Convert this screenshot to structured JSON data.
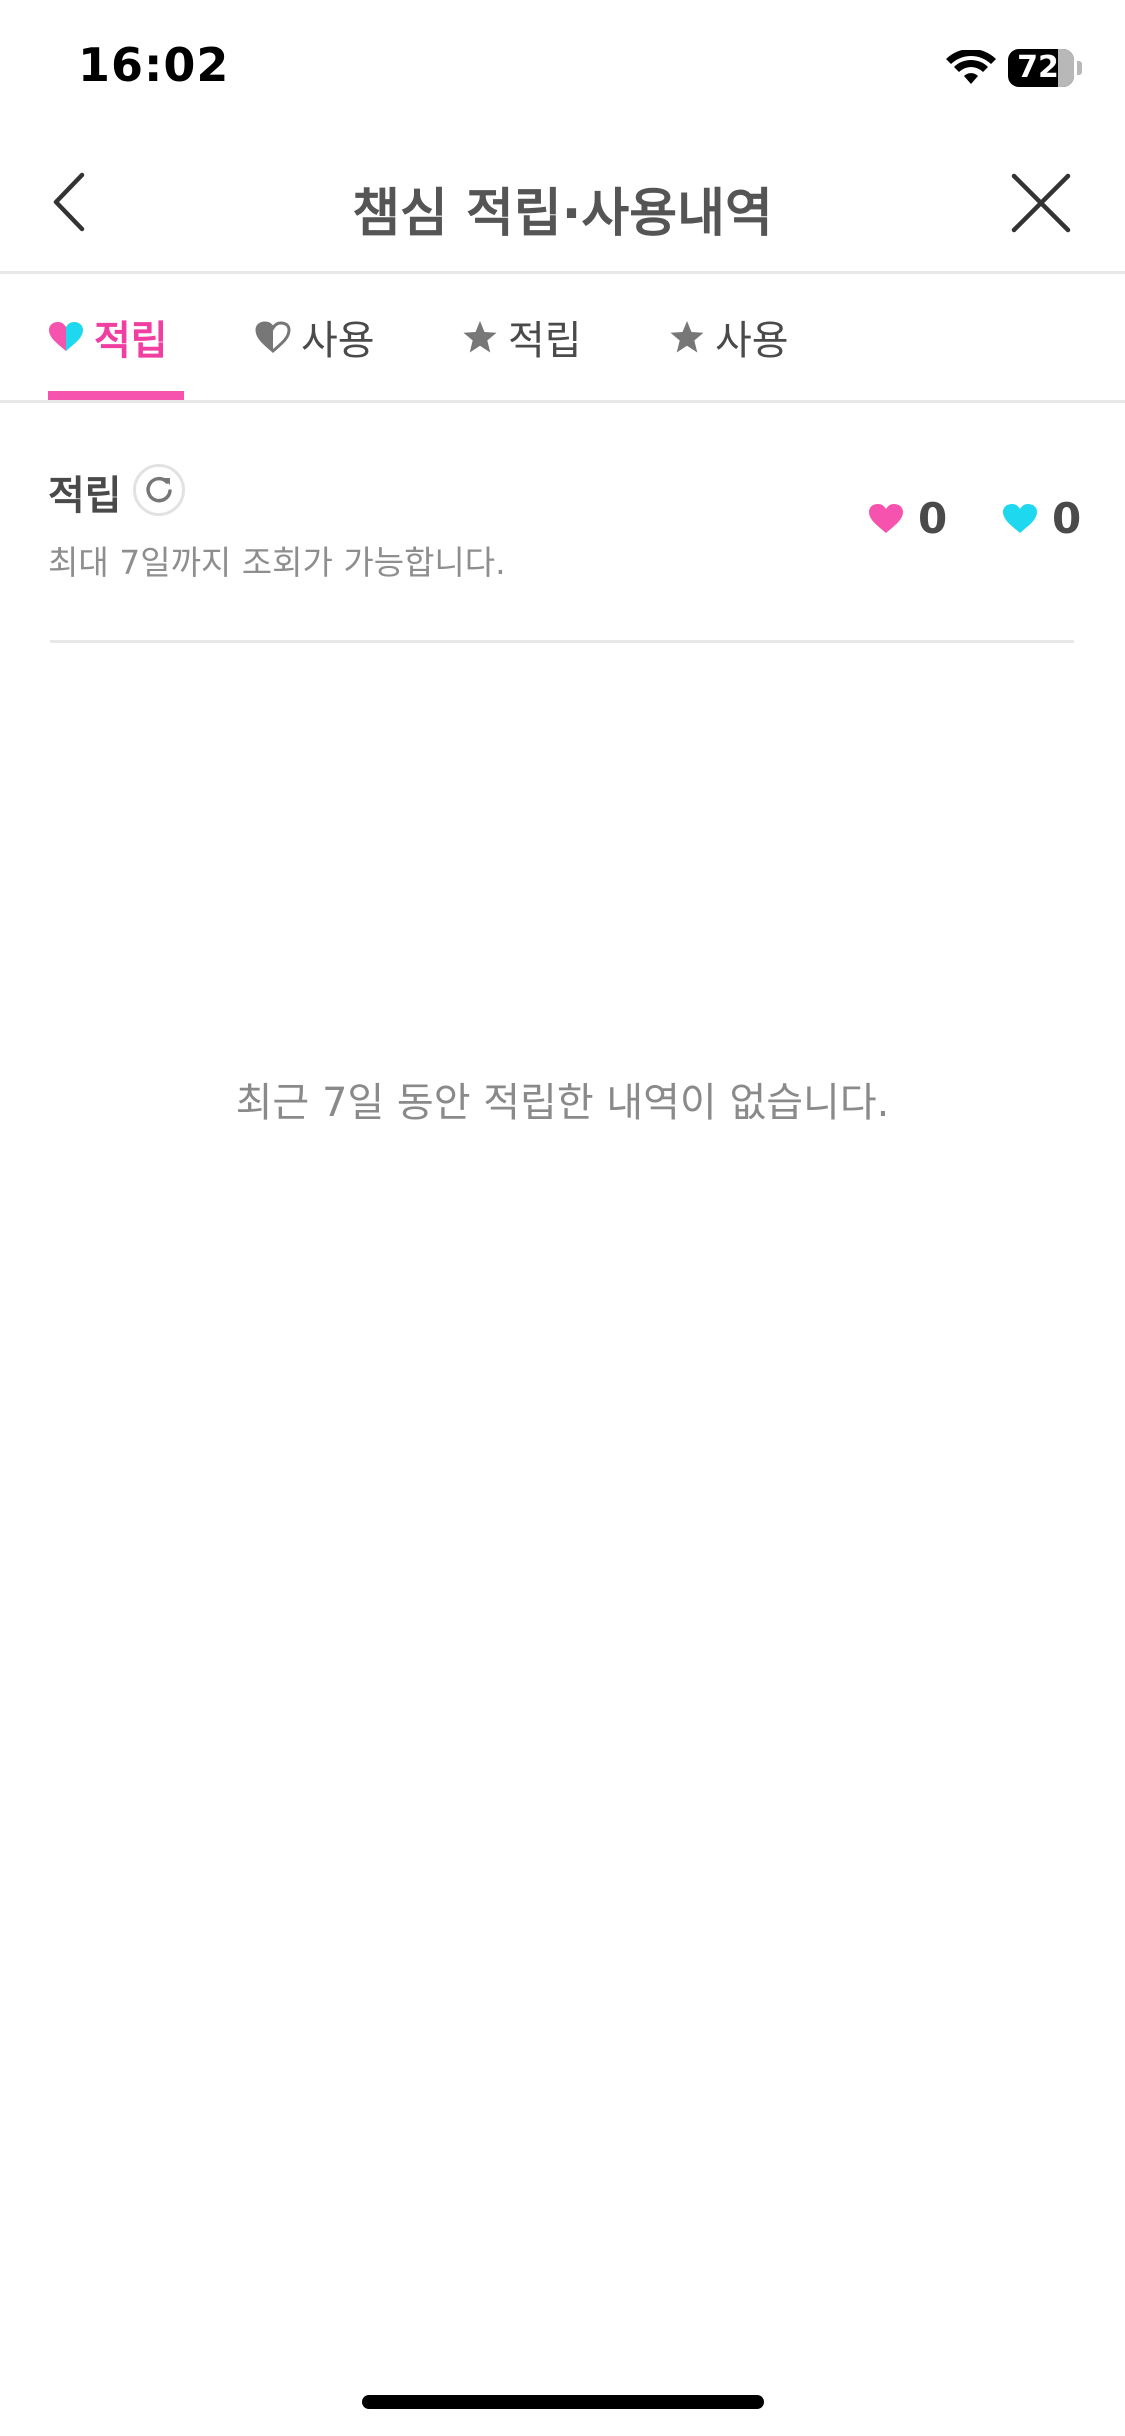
{
  "status_bar": {
    "time": "16:02",
    "battery_level": "72",
    "icons": [
      "wifi-icon",
      "battery-icon"
    ]
  },
  "header": {
    "title": "챔심 적립·사용내역",
    "back_icon": "chevron-left-icon",
    "close_icon": "close-icon"
  },
  "tabs": [
    {
      "label": "적립",
      "icon": "half-heart-pink-cyan-icon",
      "active": true
    },
    {
      "label": "사용",
      "icon": "half-heart-outline-icon",
      "active": false
    },
    {
      "label": "적립",
      "icon": "star-icon",
      "active": false
    },
    {
      "label": "사용",
      "icon": "star-icon",
      "active": false
    }
  ],
  "summary": {
    "title": "적립",
    "refresh_icon": "refresh-icon",
    "note": "최대 7일까지 조회가 가능합니다.",
    "pink_heart_count": "0",
    "cyan_heart_count": "0"
  },
  "empty_state": {
    "message": "최근 7일 동안 적립한 내역이 없습니다."
  },
  "colors": {
    "accent_pink": "#f553ad",
    "accent_cyan": "#1ed8f0",
    "text_primary": "#4a4a4a",
    "text_secondary": "#8e8e8e",
    "divider": "#e8e8e8"
  }
}
